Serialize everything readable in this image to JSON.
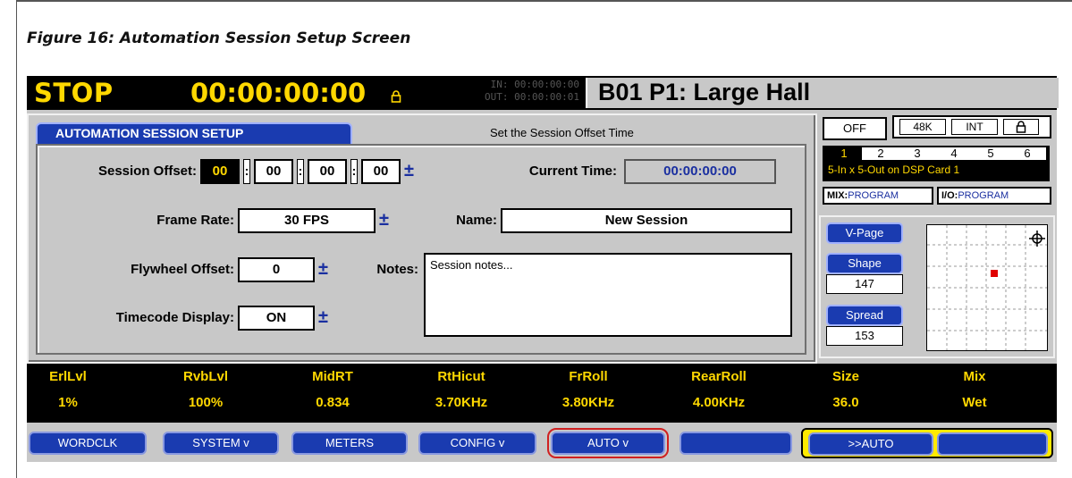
{
  "caption": "Figure 16: Automation Session Setup Screen",
  "status": {
    "transport": "STOP",
    "timecode": "00:00:00:00",
    "lock_icon": "lock-icon",
    "in_label": "IN: 00:00:00:00",
    "out_label": "OUT: 00:00:00:01",
    "preset": "B01 P1: Large Hall"
  },
  "panel": {
    "tab_label": "AUTOMATION SESSION SETUP",
    "hint": "Set the Session Offset Time",
    "session_offset_label": "Session Offset:",
    "session_offset": [
      "00",
      "00",
      "00",
      "00"
    ],
    "colon": ":",
    "plusminus": "±",
    "current_time_label": "Current Time:",
    "current_time": "00:00:00:00",
    "frame_rate_label": "Frame Rate:",
    "frame_rate": "30 FPS",
    "name_label": "Name:",
    "name": "New Session",
    "flywheel_label": "Flywheel Offset:",
    "flywheel": "0",
    "notes_label": "Notes:",
    "notes": "Session notes...",
    "timecode_display_label": "Timecode Display:",
    "timecode_display": "ON"
  },
  "right": {
    "off": "OFF",
    "rate": "48K",
    "clock": "INT",
    "lock_icon": "lock-icon",
    "dsp_slots": [
      "1",
      "2",
      "3",
      "4",
      "5",
      "6"
    ],
    "dsp_text": "5-In x 5-Out on DSP Card 1",
    "mix_label": "MIX:",
    "mix_value": "PROGRAM",
    "io_label": "I/O:",
    "io_value": "PROGRAM",
    "vpage": "V-Page",
    "shape_label": "Shape",
    "shape_value": "147",
    "spread_label": "Spread",
    "spread_value": "153",
    "crosshair_icon": "crosshair-icon",
    "colors": {
      "marker": "#e00000",
      "accent": "#1a3bb0",
      "highlight": "#ffd800"
    }
  },
  "params": [
    {
      "name": "ErlLvl",
      "value": "1%"
    },
    {
      "name": "RvbLvl",
      "value": "100%"
    },
    {
      "name": "MidRT",
      "value": "0.834"
    },
    {
      "name": "RtHicut",
      "value": "3.70KHz"
    },
    {
      "name": "FrRoll",
      "value": "3.80KHz"
    },
    {
      "name": "RearRoll",
      "value": "4.00KHz"
    },
    {
      "name": "Size",
      "value": "36.0"
    },
    {
      "name": "Mix",
      "value": "Wet"
    }
  ],
  "softkeys": {
    "wordclk": "WORDCLK",
    "system": "SYSTEM v",
    "meters": "METERS",
    "config": "CONFIG v",
    "auto": "AUTO v",
    "blank": "",
    "to_auto": ">>AUTO",
    "blank2": ""
  }
}
